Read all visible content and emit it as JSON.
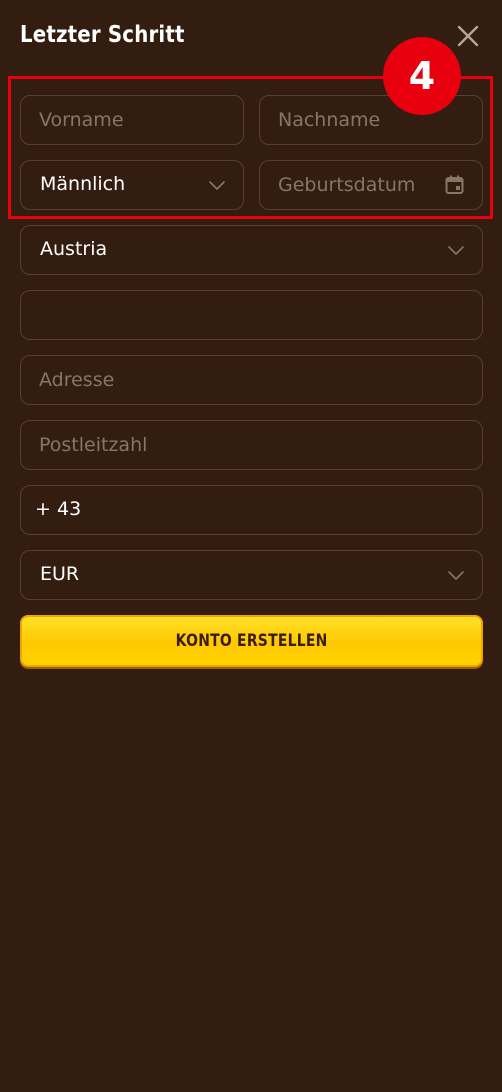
{
  "header": {
    "title": "Letzter Schritt",
    "close_icon": "close-icon"
  },
  "form": {
    "first_name": {
      "value": "",
      "placeholder": "Vorname"
    },
    "last_name": {
      "value": "",
      "placeholder": "Nachname"
    },
    "gender": {
      "selected": "Männlich",
      "icon": "chevron-down-icon"
    },
    "birthdate": {
      "value": "",
      "placeholder": "Geburtsdatum",
      "icon": "calendar-icon"
    },
    "country": {
      "selected": "Austria",
      "icon": "chevron-down-icon"
    },
    "city": {
      "value": "",
      "placeholder": ""
    },
    "address": {
      "value": "",
      "placeholder": "Adresse"
    },
    "postal_code": {
      "value": "",
      "placeholder": "Postleitzahl"
    },
    "phone": {
      "prefix": "+",
      "code": "43",
      "value": ""
    },
    "currency": {
      "selected": "EUR",
      "icon": "chevron-down-icon"
    },
    "submit_label": "KONTO ERSTELLEN"
  },
  "annotation": {
    "step_number": "4",
    "color": "#e8000e"
  },
  "colors": {
    "background": "#331d11",
    "field_border": "#5a3f2d",
    "placeholder": "#8a7565",
    "button": "#ffc800",
    "button_text": "#3a1e0c"
  }
}
